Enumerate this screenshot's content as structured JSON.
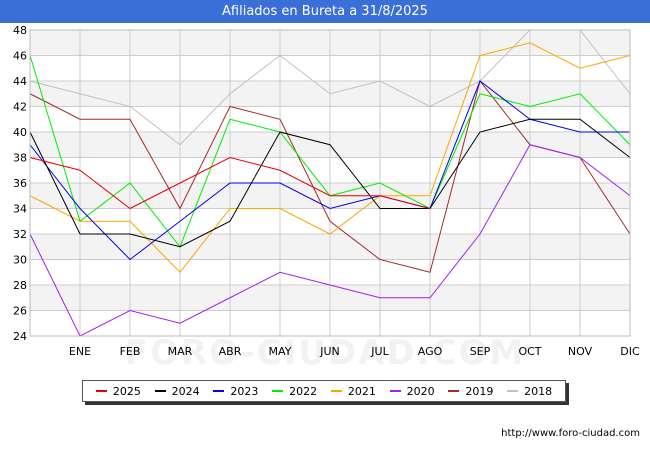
{
  "title": "Afiliados en Bureta a 31/8/2025",
  "footer": "http://www.foro-ciudad.com",
  "watermark": "FORO-CIUDAD.COM",
  "colors": {
    "title_bg": "#3a6fd8",
    "grid": "#cccccc",
    "band": "#f3f3f3"
  },
  "chart_data": {
    "type": "line",
    "title": "Afiliados en Bureta a 31/8/2025",
    "categories": [
      "",
      "ENE",
      "FEB",
      "MAR",
      "ABR",
      "MAY",
      "JUN",
      "JUL",
      "AGO",
      "SEP",
      "OCT",
      "NOV",
      "DIC"
    ],
    "ylim": [
      24,
      48
    ],
    "yticks": [
      24,
      26,
      28,
      30,
      32,
      34,
      36,
      38,
      40,
      42,
      44,
      46,
      48
    ],
    "grid": true,
    "legend_position": "bottom",
    "series": [
      {
        "name": "2025",
        "color": "#e8000b",
        "values": [
          38,
          37,
          34,
          36,
          38,
          37,
          35,
          35,
          34,
          null,
          null,
          null,
          null
        ]
      },
      {
        "name": "2024",
        "color": "#000000",
        "values": [
          40,
          32,
          32,
          31,
          33,
          40,
          39,
          34,
          34,
          40,
          41,
          41,
          38
        ]
      },
      {
        "name": "2023",
        "color": "#0000ee",
        "values": [
          39,
          34,
          30,
          33,
          36,
          36,
          34,
          35,
          34,
          44,
          41,
          40,
          40
        ]
      },
      {
        "name": "2022",
        "color": "#00ee00",
        "values": [
          46,
          33,
          36,
          31,
          41,
          40,
          35,
          36,
          34,
          43,
          42,
          43,
          39
        ]
      },
      {
        "name": "2021",
        "color": "#ffa500",
        "values": [
          35,
          33,
          33,
          29,
          34,
          34,
          32,
          35,
          35,
          46,
          47,
          45,
          46
        ]
      },
      {
        "name": "2020",
        "color": "#a020f0",
        "values": [
          32,
          24,
          26,
          25,
          27,
          29,
          28,
          27,
          27,
          32,
          39,
          38,
          35
        ]
      },
      {
        "name": "2019",
        "color": "#a52a2a",
        "values": [
          43,
          41,
          41,
          34,
          42,
          41,
          33,
          30,
          29,
          44,
          39,
          38,
          32
        ]
      },
      {
        "name": "2018",
        "color": "#c0c0c0",
        "values": [
          44,
          43,
          42,
          39,
          43,
          46,
          43,
          44,
          42,
          44,
          48,
          48,
          43
        ]
      }
    ]
  }
}
